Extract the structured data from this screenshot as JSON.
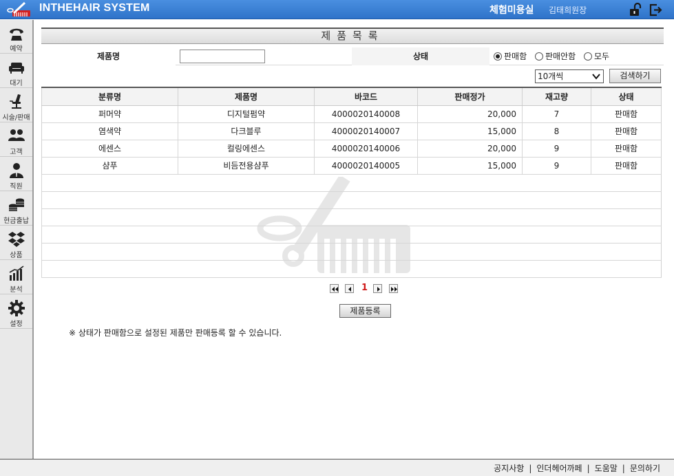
{
  "header": {
    "app_title": "INTHEHAIR SYSTEM",
    "shop_name": "체험미용실",
    "user_name": "김태희원장"
  },
  "sidebar": {
    "items": [
      {
        "label": "예약",
        "icon": "phone-icon"
      },
      {
        "label": "대기",
        "icon": "sofa-icon"
      },
      {
        "label": "시술/판매",
        "icon": "chair-icon"
      },
      {
        "label": "고객",
        "icon": "customers-icon"
      },
      {
        "label": "직원",
        "icon": "staff-icon"
      },
      {
        "label": "현금출납",
        "icon": "coins-icon"
      },
      {
        "label": "상품",
        "icon": "boxes-icon"
      },
      {
        "label": "분석",
        "icon": "chart-icon"
      },
      {
        "label": "설정",
        "icon": "gear-icon"
      }
    ]
  },
  "main": {
    "title": "제품목록",
    "filter": {
      "product_label": "제품명",
      "product_value": "",
      "status_label": "상태",
      "status_options": [
        "판매함",
        "판매안함",
        "모두"
      ],
      "status_selected": "판매함"
    },
    "per_page": "10개씩",
    "search_button": "검색하기",
    "table": {
      "headers": [
        "분류명",
        "제품명",
        "바코드",
        "판매정가",
        "재고량",
        "상태"
      ],
      "rows": [
        [
          "퍼머약",
          "디지털펌약",
          "4000020140008",
          "20,000",
          "7",
          "판매함"
        ],
        [
          "염색약",
          "다크블루",
          "4000020140007",
          "15,000",
          "8",
          "판매함"
        ],
        [
          "에센스",
          "컬링에센스",
          "4000020140006",
          "20,000",
          "9",
          "판매함"
        ],
        [
          "샴푸",
          "비듬전용샴푸",
          "4000020140005",
          "15,000",
          "9",
          "판매함"
        ]
      ],
      "empty_rows": 6
    },
    "pager": {
      "current": "1"
    },
    "register_button": "제품등록",
    "note": "※ 상태가 판매함으로 설정된 제품만 판매등록 할 수 있습니다."
  },
  "footer": {
    "links": [
      "공지사항",
      "인더헤어까페",
      "도움말",
      "문의하기"
    ]
  },
  "colors": {
    "header_blue": "#3b7fd6",
    "page_number_red": "#d01a1a"
  }
}
